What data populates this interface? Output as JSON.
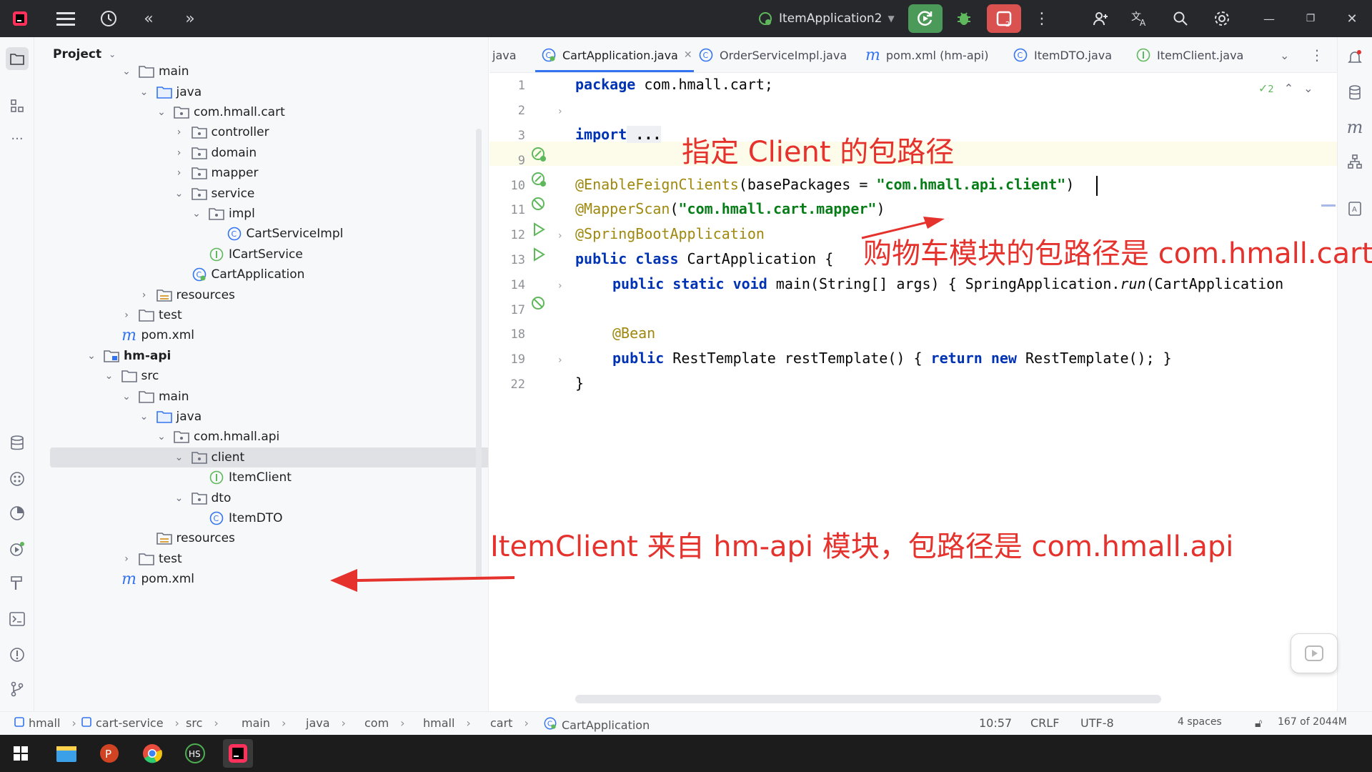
{
  "titlebar": {
    "run_config": "ItemApplication2"
  },
  "project_panel": {
    "title": "Project",
    "tree": [
      {
        "label": "main",
        "indent": 0,
        "chev": "down",
        "icon": "folder"
      },
      {
        "label": "java",
        "indent": 1,
        "chev": "down",
        "icon": "folder-blue"
      },
      {
        "label": "com.hmall.cart",
        "indent": 2,
        "chev": "down",
        "icon": "package"
      },
      {
        "label": "controller",
        "indent": 3,
        "chev": "right",
        "icon": "package"
      },
      {
        "label": "domain",
        "indent": 3,
        "chev": "right",
        "icon": "package"
      },
      {
        "label": "mapper",
        "indent": 3,
        "chev": "right",
        "icon": "package"
      },
      {
        "label": "service",
        "indent": 3,
        "chev": "down",
        "icon": "package"
      },
      {
        "label": "impl",
        "indent": 4,
        "chev": "down",
        "icon": "package"
      },
      {
        "label": "CartServiceImpl",
        "indent": 5,
        "chev": "",
        "icon": "class"
      },
      {
        "label": "ICartService",
        "indent": 4,
        "chev": "",
        "icon": "interface"
      },
      {
        "label": "CartApplication",
        "indent": 3,
        "chev": "",
        "icon": "spring-class"
      },
      {
        "label": "resources",
        "indent": 1,
        "chev": "right",
        "icon": "resources"
      },
      {
        "label": "test",
        "indent": 0,
        "chev": "right",
        "icon": "folder"
      },
      {
        "label": "pom.xml",
        "indent": -1,
        "chev": "",
        "icon": "maven"
      },
      {
        "label": "hm-api",
        "indent": -2,
        "chev": "down",
        "icon": "module",
        "bold": true
      },
      {
        "label": "src",
        "indent": -1,
        "chev": "down",
        "icon": "folder"
      },
      {
        "label": "main",
        "indent": 0,
        "chev": "down",
        "icon": "folder"
      },
      {
        "label": "java",
        "indent": 1,
        "chev": "down",
        "icon": "folder-blue"
      },
      {
        "label": "com.hmall.api",
        "indent": 2,
        "chev": "down",
        "icon": "package"
      },
      {
        "label": "client",
        "indent": 3,
        "chev": "down",
        "icon": "package",
        "selected": true
      },
      {
        "label": "ItemClient",
        "indent": 4,
        "chev": "",
        "icon": "interface"
      },
      {
        "label": "dto",
        "indent": 3,
        "chev": "down",
        "icon": "package"
      },
      {
        "label": "ItemDTO",
        "indent": 4,
        "chev": "",
        "icon": "class"
      },
      {
        "label": "resources",
        "indent": 1,
        "chev": "",
        "icon": "resources"
      },
      {
        "label": "test",
        "indent": 0,
        "chev": "right",
        "icon": "folder"
      },
      {
        "label": "pom.xml",
        "indent": -1,
        "chev": "",
        "icon": "maven"
      }
    ]
  },
  "tabs": [
    {
      "label": "java",
      "icon": ""
    },
    {
      "label": "CartApplication.java",
      "icon": "spring-class",
      "active": true,
      "closable": true
    },
    {
      "label": "OrderServiceImpl.java",
      "icon": "class"
    },
    {
      "label": "pom.xml (hm-api)",
      "icon": "maven"
    },
    {
      "label": "ItemDTO.java",
      "icon": "class"
    },
    {
      "label": "ItemClient.java",
      "icon": "interface"
    }
  ],
  "editor": {
    "inspection_count": "2",
    "lines": [
      {
        "n": "1"
      },
      {
        "n": "2"
      },
      {
        "n": "3"
      },
      {
        "n": "9"
      },
      {
        "n": "10"
      },
      {
        "n": "11"
      },
      {
        "n": "12"
      },
      {
        "n": "13"
      },
      {
        "n": "14"
      },
      {
        "n": "17"
      },
      {
        "n": "18"
      },
      {
        "n": "19"
      },
      {
        "n": "22"
      }
    ],
    "code": {
      "l1_kw": "package",
      "l1_rest": " com.hmall.cart;",
      "l3_kw": "import",
      "l3_rest": " ...",
      "l10_ann": "@EnableFeignClients",
      "l10_a": "(basePackages = ",
      "l10_str": "\"com.hmall.api.client\"",
      "l10_b": ")",
      "l11_ann": "@MapperScan",
      "l11_a": "(",
      "l11_str": "\"com.hmall.cart.mapper\"",
      "l11_b": ")",
      "l12_ann": "@SpringBootApplication",
      "l13_kw": "public class",
      "l13_rest": " CartApplication {",
      "l14_kw": "public static void",
      "l14_a": " main(String[] args) { SpringApplication.",
      "l14_it": "run",
      "l14_b": "(CartApplication",
      "l18_ann": "@Bean",
      "l19_kw": "public",
      "l19_a": " RestTemplate restTemplate() { ",
      "l19_kw2": "return new",
      "l19_b": " RestTemplate(); }",
      "l22": "}"
    }
  },
  "annotations": {
    "client_path": "指定 Client 的包路径",
    "cart_path": "购物车模块的包路径是 com.hmall.cart",
    "itemclient_path": "ItemClient 来自 hm-api 模块，包路径是 com.hmall.api"
  },
  "statusbar": {
    "breadcrumbs": [
      "hmall",
      "cart-service",
      "src",
      "main",
      "java",
      "com",
      "hmall",
      "cart",
      "CartApplication"
    ],
    "position": "10:57",
    "line_sep": "CRLF",
    "encoding": "UTF-8",
    "indent": "4 spaces",
    "memory": "167 of 2044M"
  },
  "colors": {
    "annotation_red": "#e5322d",
    "accent_blue": "#3574f0",
    "run_green": "#4c9a5a",
    "stop_red": "#d9524f"
  }
}
